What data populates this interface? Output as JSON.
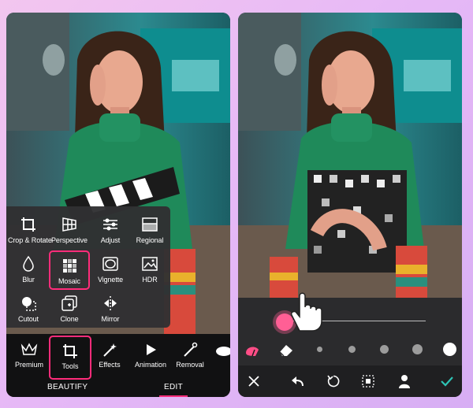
{
  "left_screen": {
    "tools_menu": {
      "items": [
        {
          "label": "Crop & Rotate",
          "icon": "crop-rotate-icon"
        },
        {
          "label": "Perspective",
          "icon": "perspective-icon"
        },
        {
          "label": "Adjust",
          "icon": "adjust-icon"
        },
        {
          "label": "Regional",
          "icon": "regional-icon"
        },
        {
          "label": "Blur",
          "icon": "blur-icon"
        },
        {
          "label": "Mosaic",
          "icon": "mosaic-icon",
          "selected": true
        },
        {
          "label": "Vignette",
          "icon": "vignette-icon"
        },
        {
          "label": "HDR",
          "icon": "hdr-icon"
        },
        {
          "label": "Cutout",
          "icon": "cutout-icon"
        },
        {
          "label": "Clone",
          "icon": "clone-icon"
        },
        {
          "label": "Mirror",
          "icon": "mirror-icon"
        }
      ]
    },
    "bottom_bar": {
      "items": [
        {
          "label": "Premium",
          "icon": "crown-icon"
        },
        {
          "label": "Tools",
          "icon": "tools-crop-icon",
          "selected": true
        },
        {
          "label": "Effects",
          "icon": "effects-wand-icon"
        },
        {
          "label": "Animation",
          "icon": "play-icon"
        },
        {
          "label": "Removal",
          "icon": "removal-icon"
        }
      ],
      "tabs": {
        "beautify": "BEAUTIFY",
        "edit": "EDIT"
      }
    }
  },
  "right_screen": {
    "brush_tools": [
      "brush-icon",
      "eraser-icon"
    ],
    "brush_sizes": 5,
    "actions": [
      "close-icon",
      "undo-icon",
      "reset-icon",
      "select-icon",
      "person-icon",
      "check-icon"
    ]
  },
  "colors": {
    "accent": "#ff2c7a",
    "thumb": "#ff5f95",
    "check": "#2ec4b6"
  }
}
